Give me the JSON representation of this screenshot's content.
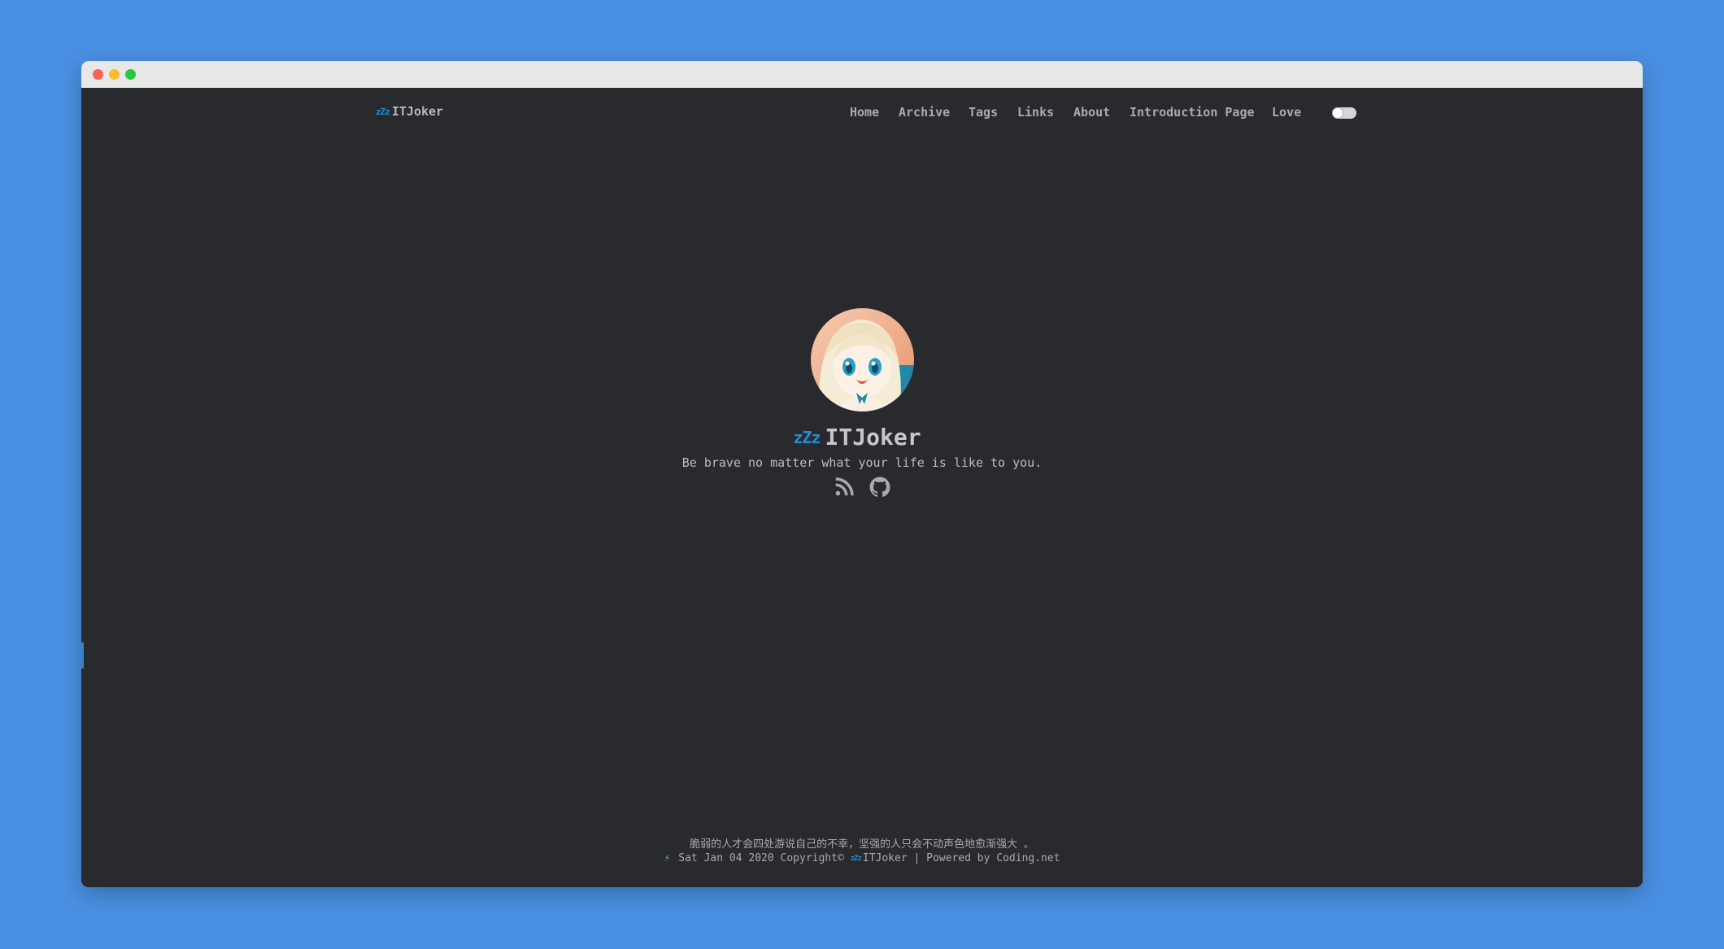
{
  "header": {
    "logo_mark": "zZz",
    "logo_text": "ITJoker",
    "nav": {
      "home": "Home",
      "archive": "Archive",
      "tags": "Tags",
      "links": "Links",
      "about": "About",
      "intro": "Introduction Page",
      "love": "Love"
    },
    "theme_toggle": {
      "state": "off",
      "icon": "toggle-switch-icon"
    }
  },
  "profile": {
    "avatar_icon": "avatar-anime-girl",
    "title_mark": "zZz",
    "title": "ITJoker",
    "subtitle": "Be brave no matter what your life is like to you.",
    "social_icons": [
      "rss-icon",
      "github-icon"
    ]
  },
  "footer": {
    "quote": "脆弱的人才会四处游说自己的不幸，坚强的人只会不动声色地愈渐强大 。",
    "bolt": "⚡",
    "date_copyright": "Sat Jan 04 2020 Copyright©",
    "mark": "zZz",
    "author": "ITJoker",
    "separator": "|",
    "powered_by": "Powered by",
    "platform": "Coding.net"
  },
  "colors": {
    "background_outer": "#4a90e2",
    "page_bg": "#292a2d",
    "text": "#a9a9b3",
    "accent": "#1e8fd8"
  }
}
